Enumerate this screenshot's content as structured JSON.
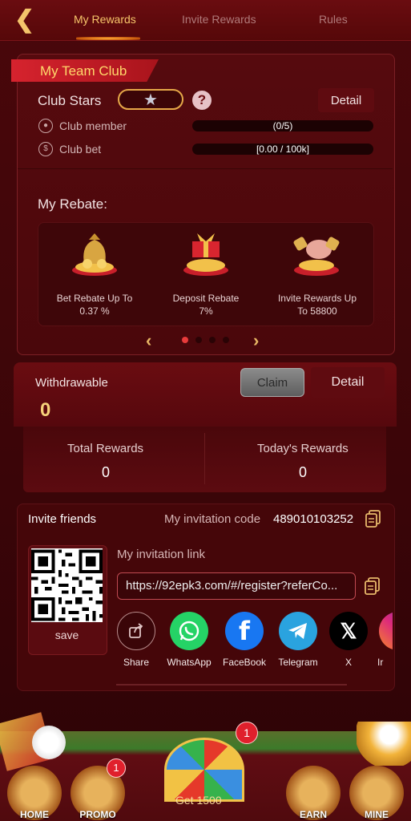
{
  "header": {
    "back_icon": "back-arrow-icon",
    "tabs": [
      {
        "label": "My Rewards",
        "active": true
      },
      {
        "label": "Invite Rewards",
        "active": false
      },
      {
        "label": "Rules",
        "active": false
      }
    ]
  },
  "team_club": {
    "banner": "My Team Club",
    "club_stars_label": "Club Stars",
    "star_icon": "star-icon",
    "detail_label": "Detail",
    "rows": [
      {
        "label": "Club member",
        "value": "(0/5)",
        "icon": "person-icon"
      },
      {
        "label": "Club bet",
        "value": "[0.00 / 100k]",
        "icon": "coin-icon"
      }
    ],
    "rebate_title": "My Rebate:",
    "rebates": [
      {
        "line1": "Bet Rebate Up To",
        "line2": "0.37 %",
        "icon": "money-bag-icon"
      },
      {
        "line1": "Deposit Rebate",
        "line2": "7%",
        "icon": "gift-coins-icon"
      },
      {
        "line1": "Invite Rewards Up",
        "line2": "To 58800",
        "icon": "piggy-bank-icon"
      }
    ],
    "carousel": {
      "active_index": 0,
      "count": 4
    }
  },
  "withdraw": {
    "label": "Withdrawable",
    "value": "0",
    "claim_label": "Claim",
    "detail_label": "Detail",
    "total_label": "Total Rewards",
    "total_value": "0",
    "today_label": "Today's Rewards",
    "today_value": "0"
  },
  "invite": {
    "title": "Invite friends",
    "code_label": "My invitation code",
    "code_value": "489010103252",
    "link_label": "My invitation link",
    "link_value": "https://92epk3.com/#/register?referCo...",
    "save_label": "save",
    "share": [
      {
        "label": "Share",
        "color": "#3a0508"
      },
      {
        "label": "WhatsApp",
        "color": "#25d366"
      },
      {
        "label": "FaceBook",
        "color": "#1877f2"
      },
      {
        "label": "Telegram",
        "color": "#2aa3df"
      },
      {
        "label": "X",
        "color": "#000000"
      },
      {
        "label": "Ir",
        "color": "#c13584"
      }
    ]
  },
  "bottom_nav": {
    "home": "HOME",
    "promo": "PROMO",
    "promo_badge": "1",
    "center_badge": "1",
    "center_label": "Get 1500",
    "earn": "EARN",
    "mine": "MINE"
  }
}
